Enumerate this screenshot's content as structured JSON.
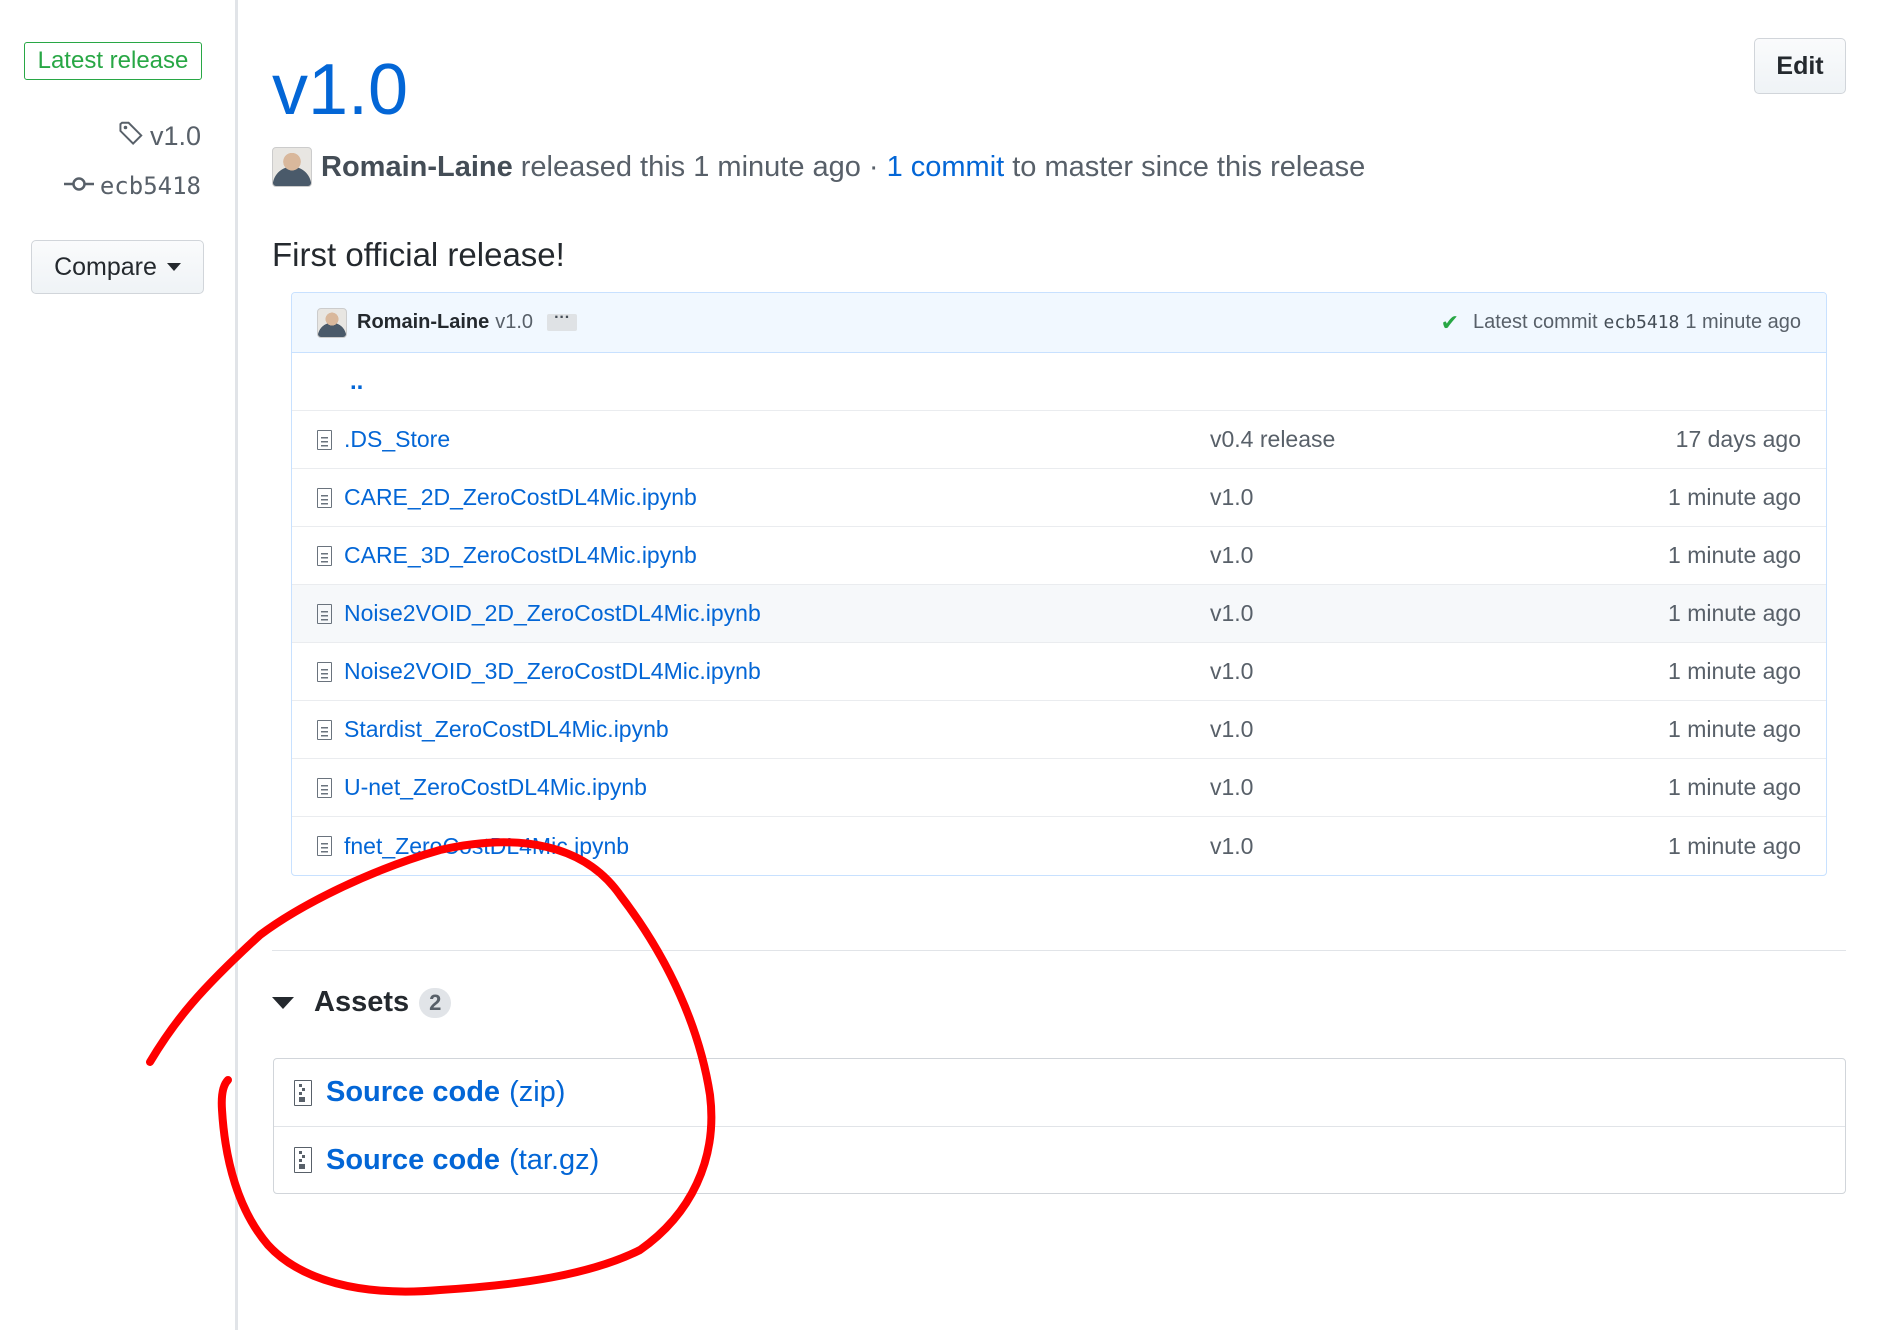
{
  "sidebar": {
    "latest_badge": "Latest release",
    "tag": "v1.0",
    "commit_sha": "ecb5418",
    "compare_label": "Compare"
  },
  "release": {
    "title": "v1.0",
    "edit_label": "Edit",
    "author": "Romain-Laine",
    "released_text": "released this 1 minute ago",
    "separator": "·",
    "commit_link": "1 commit",
    "commit_suffix": "to master since this release",
    "description": "First official release!"
  },
  "file_browser": {
    "commit_author": "Romain-Laine",
    "commit_message": "v1.0",
    "ellipsis": "···",
    "latest_commit_label": "Latest commit",
    "latest_commit_sha": "ecb5418",
    "latest_commit_age": "1 minute ago",
    "parent_dir": "..",
    "files": [
      {
        "name": ".DS_Store",
        "message": "v0.4 release",
        "age": "17 days ago"
      },
      {
        "name": "CARE_2D_ZeroCostDL4Mic.ipynb",
        "message": "v1.0",
        "age": "1 minute ago"
      },
      {
        "name": "CARE_3D_ZeroCostDL4Mic.ipynb",
        "message": "v1.0",
        "age": "1 minute ago"
      },
      {
        "name": "Noise2VOID_2D_ZeroCostDL4Mic.ipynb",
        "message": "v1.0",
        "age": "1 minute ago"
      },
      {
        "name": "Noise2VOID_3D_ZeroCostDL4Mic.ipynb",
        "message": "v1.0",
        "age": "1 minute ago"
      },
      {
        "name": "Stardist_ZeroCostDL4Mic.ipynb",
        "message": "v1.0",
        "age": "1 minute ago"
      },
      {
        "name": "U-net_ZeroCostDL4Mic.ipynb",
        "message": "v1.0",
        "age": "1 minute ago"
      },
      {
        "name": "fnet_ZeroCostDL4Mic.ipynb",
        "message": "v1.0",
        "age": "1 minute ago"
      }
    ]
  },
  "assets": {
    "label": "Assets",
    "count": "2",
    "items": [
      {
        "main": "Source code",
        "ext": "(zip)"
      },
      {
        "main": "Source code",
        "ext": "(tar.gz)"
      }
    ]
  },
  "colors": {
    "link": "#0366d6",
    "badge_green": "#28a745",
    "annotation_red": "#ff0000"
  }
}
